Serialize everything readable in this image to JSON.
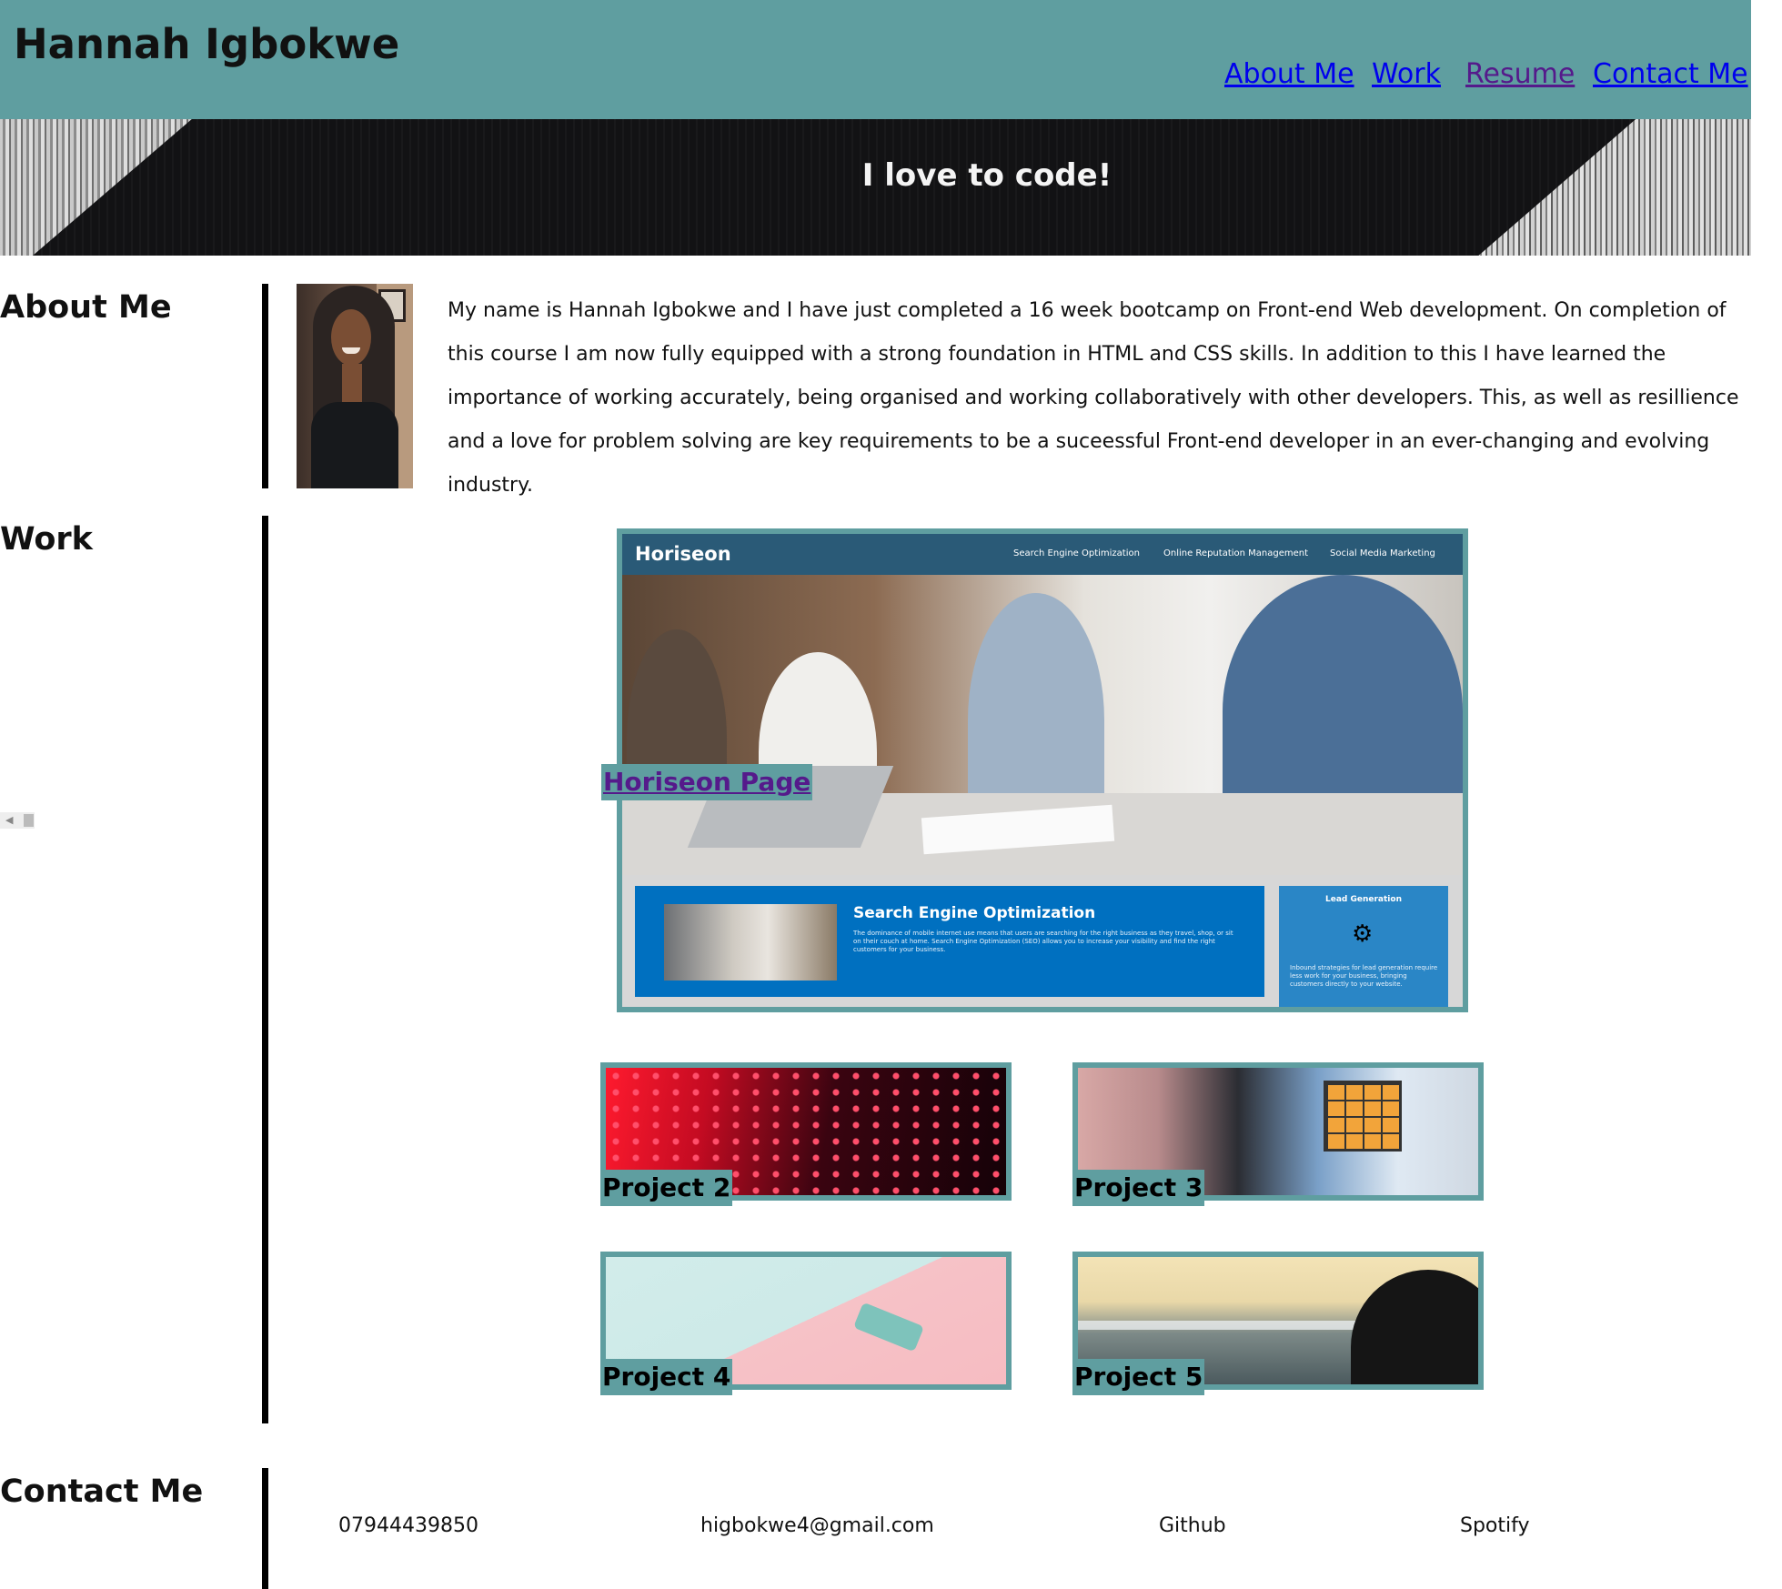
{
  "header": {
    "site_title": "Hannah Igbokwe",
    "nav": [
      {
        "label": "About Me",
        "visited": false
      },
      {
        "label": "Work",
        "visited": false
      },
      {
        "label": "Resume",
        "visited": true
      },
      {
        "label": "Contact Me",
        "visited": false
      }
    ]
  },
  "hero": {
    "tagline": "I love to code!"
  },
  "about": {
    "title": "About Me",
    "text": "My name is Hannah Igbokwe and I have just completed a 16 week bootcamp on Front-end Web development. On completion of this course I am now fully equipped with a strong foundation in HTML and CSS skills. In addition to this I have learned the importance of working accurately, being organised and working collaboratively with other developers. This, as well as resillience and a love for problem solving are key requirements to be a suceessful Front-end developer in an ever-changing and evolving industry."
  },
  "work": {
    "title": "Work",
    "featured": {
      "caption": "Horiseon Page",
      "preview": {
        "logo": "Horiseon",
        "nav": [
          "Search Engine Optimization",
          "Online Reputation Management",
          "Social Media Marketing"
        ],
        "seo_title": "Search Engine Optimization",
        "seo_copy": "The dominance of mobile internet use means that users are searching for the right business as they travel, shop, or sit on their couch at home. Search Engine Optimization (SEO) allows you to increase your visibility and find the right customers for your business.",
        "lead_title": "Lead Generation",
        "lead_copy": "Inbound strategies for lead generation require less work for your business, bringing customers directly to your website."
      }
    },
    "projects": [
      {
        "caption": "Project 2"
      },
      {
        "caption": "Project 3"
      },
      {
        "caption": "Project 4"
      },
      {
        "caption": "Project 5"
      }
    ]
  },
  "contact": {
    "title": "Contact Me",
    "items": [
      "07944439850",
      "higbokwe4@gmail.com",
      "Github",
      "Spotify"
    ]
  },
  "colors": {
    "header_bg": "#5f9ea0",
    "link": "#0000ee",
    "visited_link": "#551a8b",
    "accent_border": "#5f9ea0"
  }
}
